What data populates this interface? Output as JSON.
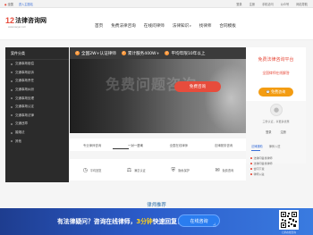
{
  "topbar": {
    "area": "全国",
    "login": "进入主题站",
    "right_links": [
      "登录",
      "注册",
      "手机访问",
      "公众号",
      "网站导航"
    ]
  },
  "header": {
    "logo_number": "12",
    "logo_text": "法律咨询网",
    "logo_sub": "www.lawyer.com",
    "nav": [
      {
        "label": "首页",
        "dropdown": false
      },
      {
        "label": "免费法律咨询",
        "dropdown": false
      },
      {
        "label": "在线问律师",
        "dropdown": false
      },
      {
        "label": "法律知识",
        "dropdown": true
      },
      {
        "label": "找律师",
        "dropdown": false
      },
      {
        "label": "合同模板",
        "dropdown": false
      }
    ]
  },
  "sidebar": {
    "title": "案件分类",
    "items": [
      "交通事故赔偿",
      "交通事故起诉",
      "交通事故责任",
      "交通事故纠纷",
      "交通事故处理",
      "交通事故认定",
      "交通事故法律",
      "交通违章",
      "婚姻法",
      "其他"
    ]
  },
  "banner": {
    "highlights": [
      "全国2W+认证律师",
      "累计服务400W+",
      "平均年限10年以上"
    ],
    "ghost_text": "免费问题咨询",
    "cta": "免费咨询"
  },
  "consult_panel": {
    "title": "免费法律咨询平台",
    "subtitle": "全国律师在线解答",
    "button": "免费咨询",
    "button_icon": "chat-icon"
  },
  "user_panel": {
    "greeting": "三秒认证，享更多优惠",
    "actions": [
      "登录",
      "注册"
    ],
    "tabs": [
      "法律援助",
      "律师入驻"
    ],
    "list": [
      "法律问答找律师",
      "法律问答找律师",
      "合同下载",
      "律师入驻"
    ]
  },
  "service_tabs": [
    "专业律师咨询",
    "一对一咨询",
    "全国在线律师",
    "法律服务咨询"
  ],
  "features": [
    {
      "icon": "clock-icon",
      "label": "平均回复"
    },
    {
      "icon": "balance-icon",
      "label": "满意认证"
    },
    {
      "icon": "shield-icon",
      "label": "隐私保护"
    },
    {
      "icon": "chat-icon",
      "label": "免费咨询"
    }
  ],
  "section_title": "律师推荐",
  "promo": {
    "text_before": "有法律疑问？咨询在线律师，",
    "text_highlight": "3分钟",
    "text_after": "快速回复！",
    "button": "在线咨询",
    "qr_caption": "扫码在线咨询"
  },
  "colors": {
    "accent": "#e74c3c",
    "orange": "#f39c12",
    "promo_blue": "#2b5bc9",
    "highlight": "#ffd11a"
  }
}
